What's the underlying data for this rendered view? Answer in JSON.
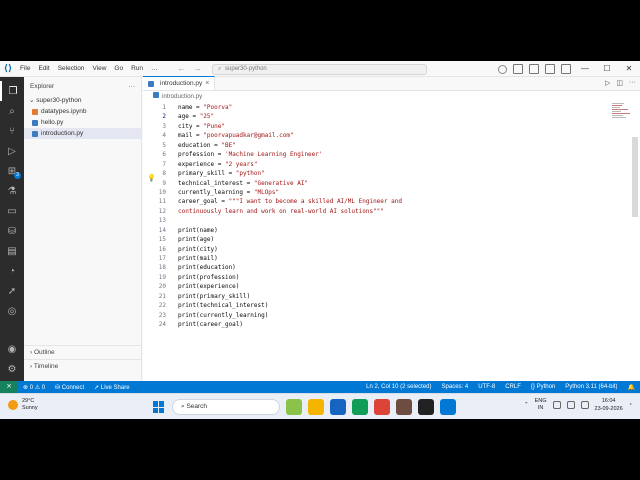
{
  "titlebar": {
    "menu": [
      "File",
      "Edit",
      "Selection",
      "View",
      "Go",
      "Run",
      "…"
    ],
    "search_text": "super30-python"
  },
  "sidebar": {
    "title": "Explorer",
    "folder": "super30-python",
    "files": [
      {
        "name": "datatypes.ipynb",
        "type": "ipynb",
        "active": false
      },
      {
        "name": "hello.py",
        "type": "py",
        "active": false
      },
      {
        "name": "introduction.py",
        "type": "py",
        "active": true
      }
    ],
    "outline": "Outline",
    "timeline": "Timeline"
  },
  "editor": {
    "tab": "introduction.py",
    "breadcrumb": "introduction.py",
    "lines": [
      {
        "n": "1",
        "pre": "name = ",
        "str": "\"Poorva\"",
        "post": ""
      },
      {
        "n": "2",
        "pre": "age = ",
        "str": "\"25\"",
        "post": ""
      },
      {
        "n": "3",
        "pre": "city = ",
        "str": "\"Pune\"",
        "post": ""
      },
      {
        "n": "4",
        "pre": "mail = ",
        "str": "\"poorvapuadkar@gmail.com\"",
        "post": ""
      },
      {
        "n": "5",
        "pre": "education = ",
        "str": "\"BE\"",
        "post": ""
      },
      {
        "n": "6",
        "pre": "profession = ",
        "str": "'Machine Learning Engineer'",
        "post": ""
      },
      {
        "n": "7",
        "pre": "experience = ",
        "str": "\"2 years\"",
        "post": ""
      },
      {
        "n": "8",
        "pre": "primary_skill = ",
        "str": "\"python\"",
        "post": ""
      },
      {
        "n": "9",
        "pre": "technical_interest = ",
        "str": "\"Generative AI\"",
        "post": ""
      },
      {
        "n": "10",
        "pre": "currently_learning = ",
        "str": "\"MLOps\"",
        "post": ""
      },
      {
        "n": "11",
        "pre": "career_goal = ",
        "str": "\"\"\"I want to become a skilled AI/ML Engineer and",
        "post": ""
      },
      {
        "n": "12",
        "pre": "",
        "str": "continuously learn and work on real-world AI solutions\"\"\"",
        "post": ""
      },
      {
        "n": "13",
        "pre": "",
        "str": "",
        "post": ""
      },
      {
        "n": "14",
        "pre": "print(name)",
        "str": "",
        "post": ""
      },
      {
        "n": "15",
        "pre": "print(age)",
        "str": "",
        "post": ""
      },
      {
        "n": "16",
        "pre": "print(city)",
        "str": "",
        "post": ""
      },
      {
        "n": "17",
        "pre": "print(mail)",
        "str": "",
        "post": ""
      },
      {
        "n": "18",
        "pre": "print(education)",
        "str": "",
        "post": ""
      },
      {
        "n": "19",
        "pre": "print(profession)",
        "str": "",
        "post": ""
      },
      {
        "n": "20",
        "pre": "print(experience)",
        "str": "",
        "post": ""
      },
      {
        "n": "21",
        "pre": "print(primary_skill)",
        "str": "",
        "post": ""
      },
      {
        "n": "22",
        "pre": "print(technical_interest)",
        "str": "",
        "post": ""
      },
      {
        "n": "23",
        "pre": "print(currently_learning)",
        "str": "",
        "post": ""
      },
      {
        "n": "24",
        "pre": "print(career_goal)",
        "str": "",
        "post": ""
      }
    ]
  },
  "statusbar": {
    "problems": "⊗ 0 ⚠ 0",
    "connect": "Connect",
    "live_share": "Live Share",
    "position": "Ln 2, Col 10 (2 selected)",
    "spaces": "Spaces: 4",
    "encoding": "UTF-8",
    "eol": "CRLF",
    "language": "Python",
    "interpreter": "Python 3.11 (64-bit)"
  },
  "taskbar": {
    "temp": "29°C",
    "weather": "Sunny",
    "search": "Search",
    "lang1": "ENG",
    "lang2": "IN",
    "time": "16:04",
    "date": "23-09-2026"
  },
  "colors": {
    "accent": "#0078d4",
    "string": "#a31515",
    "activitybar": "#2c2c2c"
  }
}
